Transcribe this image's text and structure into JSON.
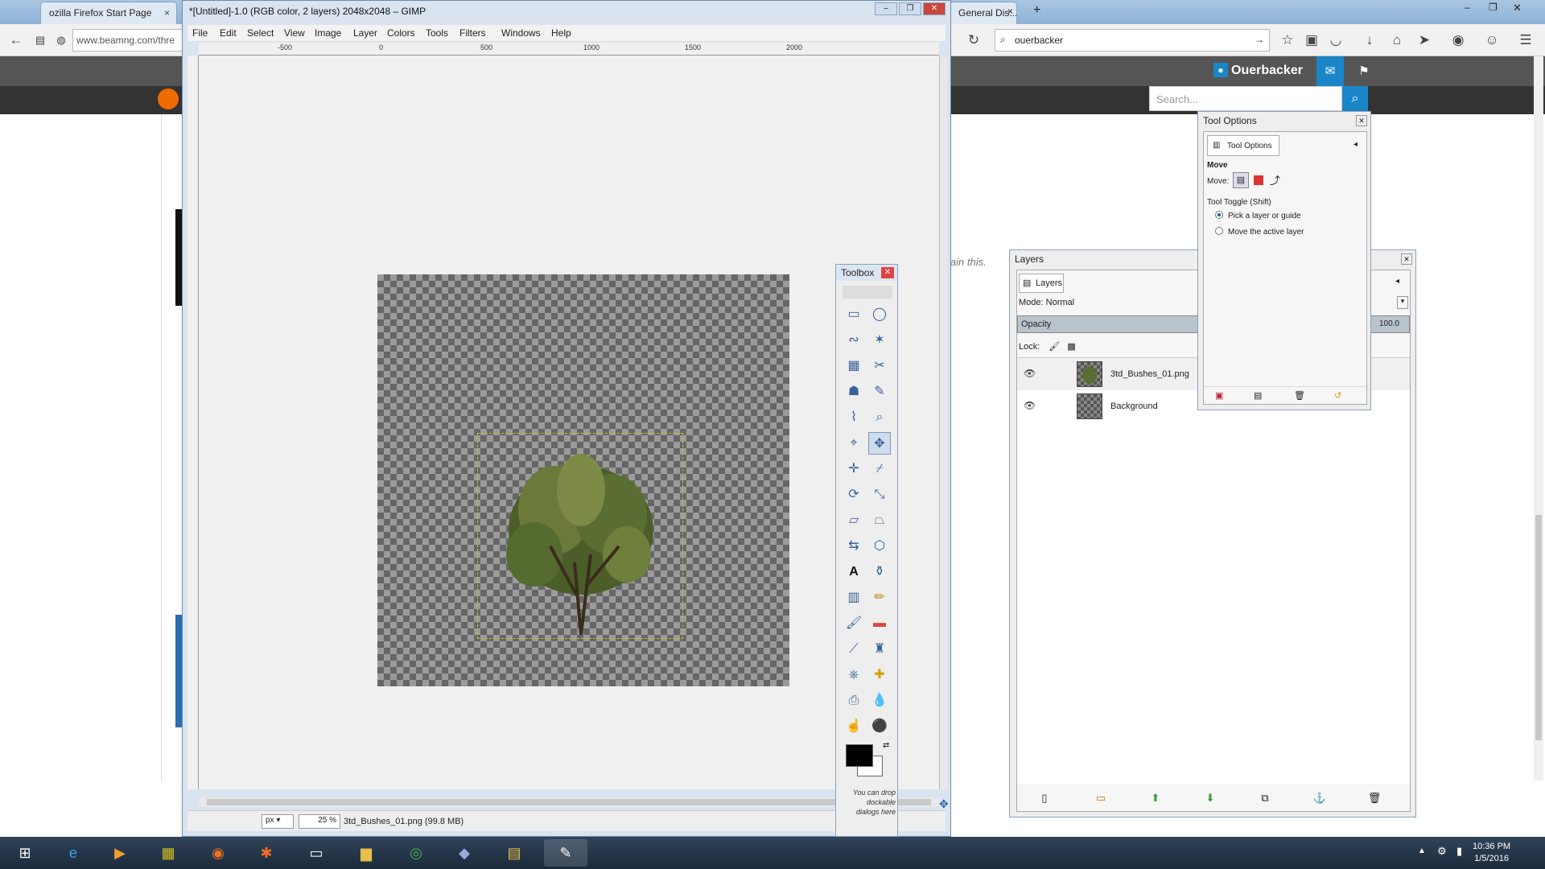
{
  "browser": {
    "tabs": [
      {
        "label": "ozilla Firefox Start Page",
        "close": "×"
      },
      {
        "label": "General Dis...",
        "close": "×"
      }
    ],
    "new_tab": "+",
    "url": "www.beamng.com/thre",
    "search_value": "ouerbacker",
    "site": {
      "user": "Ouerbacker",
      "search_placeholder": "Search...",
      "explain_text": "lain this."
    }
  },
  "gimp": {
    "title": "*[Untitled]-1.0 (RGB color, 2 layers) 2048x2048 – GIMP",
    "menu": [
      "File",
      "Edit",
      "Select",
      "View",
      "Image",
      "Layer",
      "Colors",
      "Tools",
      "Filters",
      "Windows",
      "Help"
    ],
    "ruler_labels": [
      "-500",
      "0",
      "500",
      "1000",
      "1500",
      "2000"
    ],
    "status": {
      "unit": "px",
      "zoom": "25 %",
      "text": "3td_Bushes_01.png (99.8 MB)"
    }
  },
  "toolbox": {
    "title": "Toolbox",
    "hint": "You can drop dockable dialogs here"
  },
  "layers": {
    "title": "Layers",
    "tab": "Layers",
    "mode": "Mode: Normal",
    "opacity_label": "Opacity",
    "opacity_value": "100.0",
    "lock_label": "Lock:",
    "items": [
      {
        "name": "3td_Bushes_01.png"
      },
      {
        "name": "Background"
      }
    ]
  },
  "tool_options": {
    "title": "Tool Options",
    "tab": "Tool Options",
    "section": "Move",
    "move_label": "Move:",
    "toggle_label": "Tool Toggle  (Shift)",
    "options": [
      "Pick a layer or guide",
      "Move the active layer"
    ],
    "selected_option": "Pick a layer or guide"
  },
  "taskbar": {
    "time": "10:36 PM",
    "date": "1/5/2016"
  },
  "colors": {
    "fg": "#000000",
    "bg": "#ffffff",
    "site_accent": "#1a86c8"
  }
}
